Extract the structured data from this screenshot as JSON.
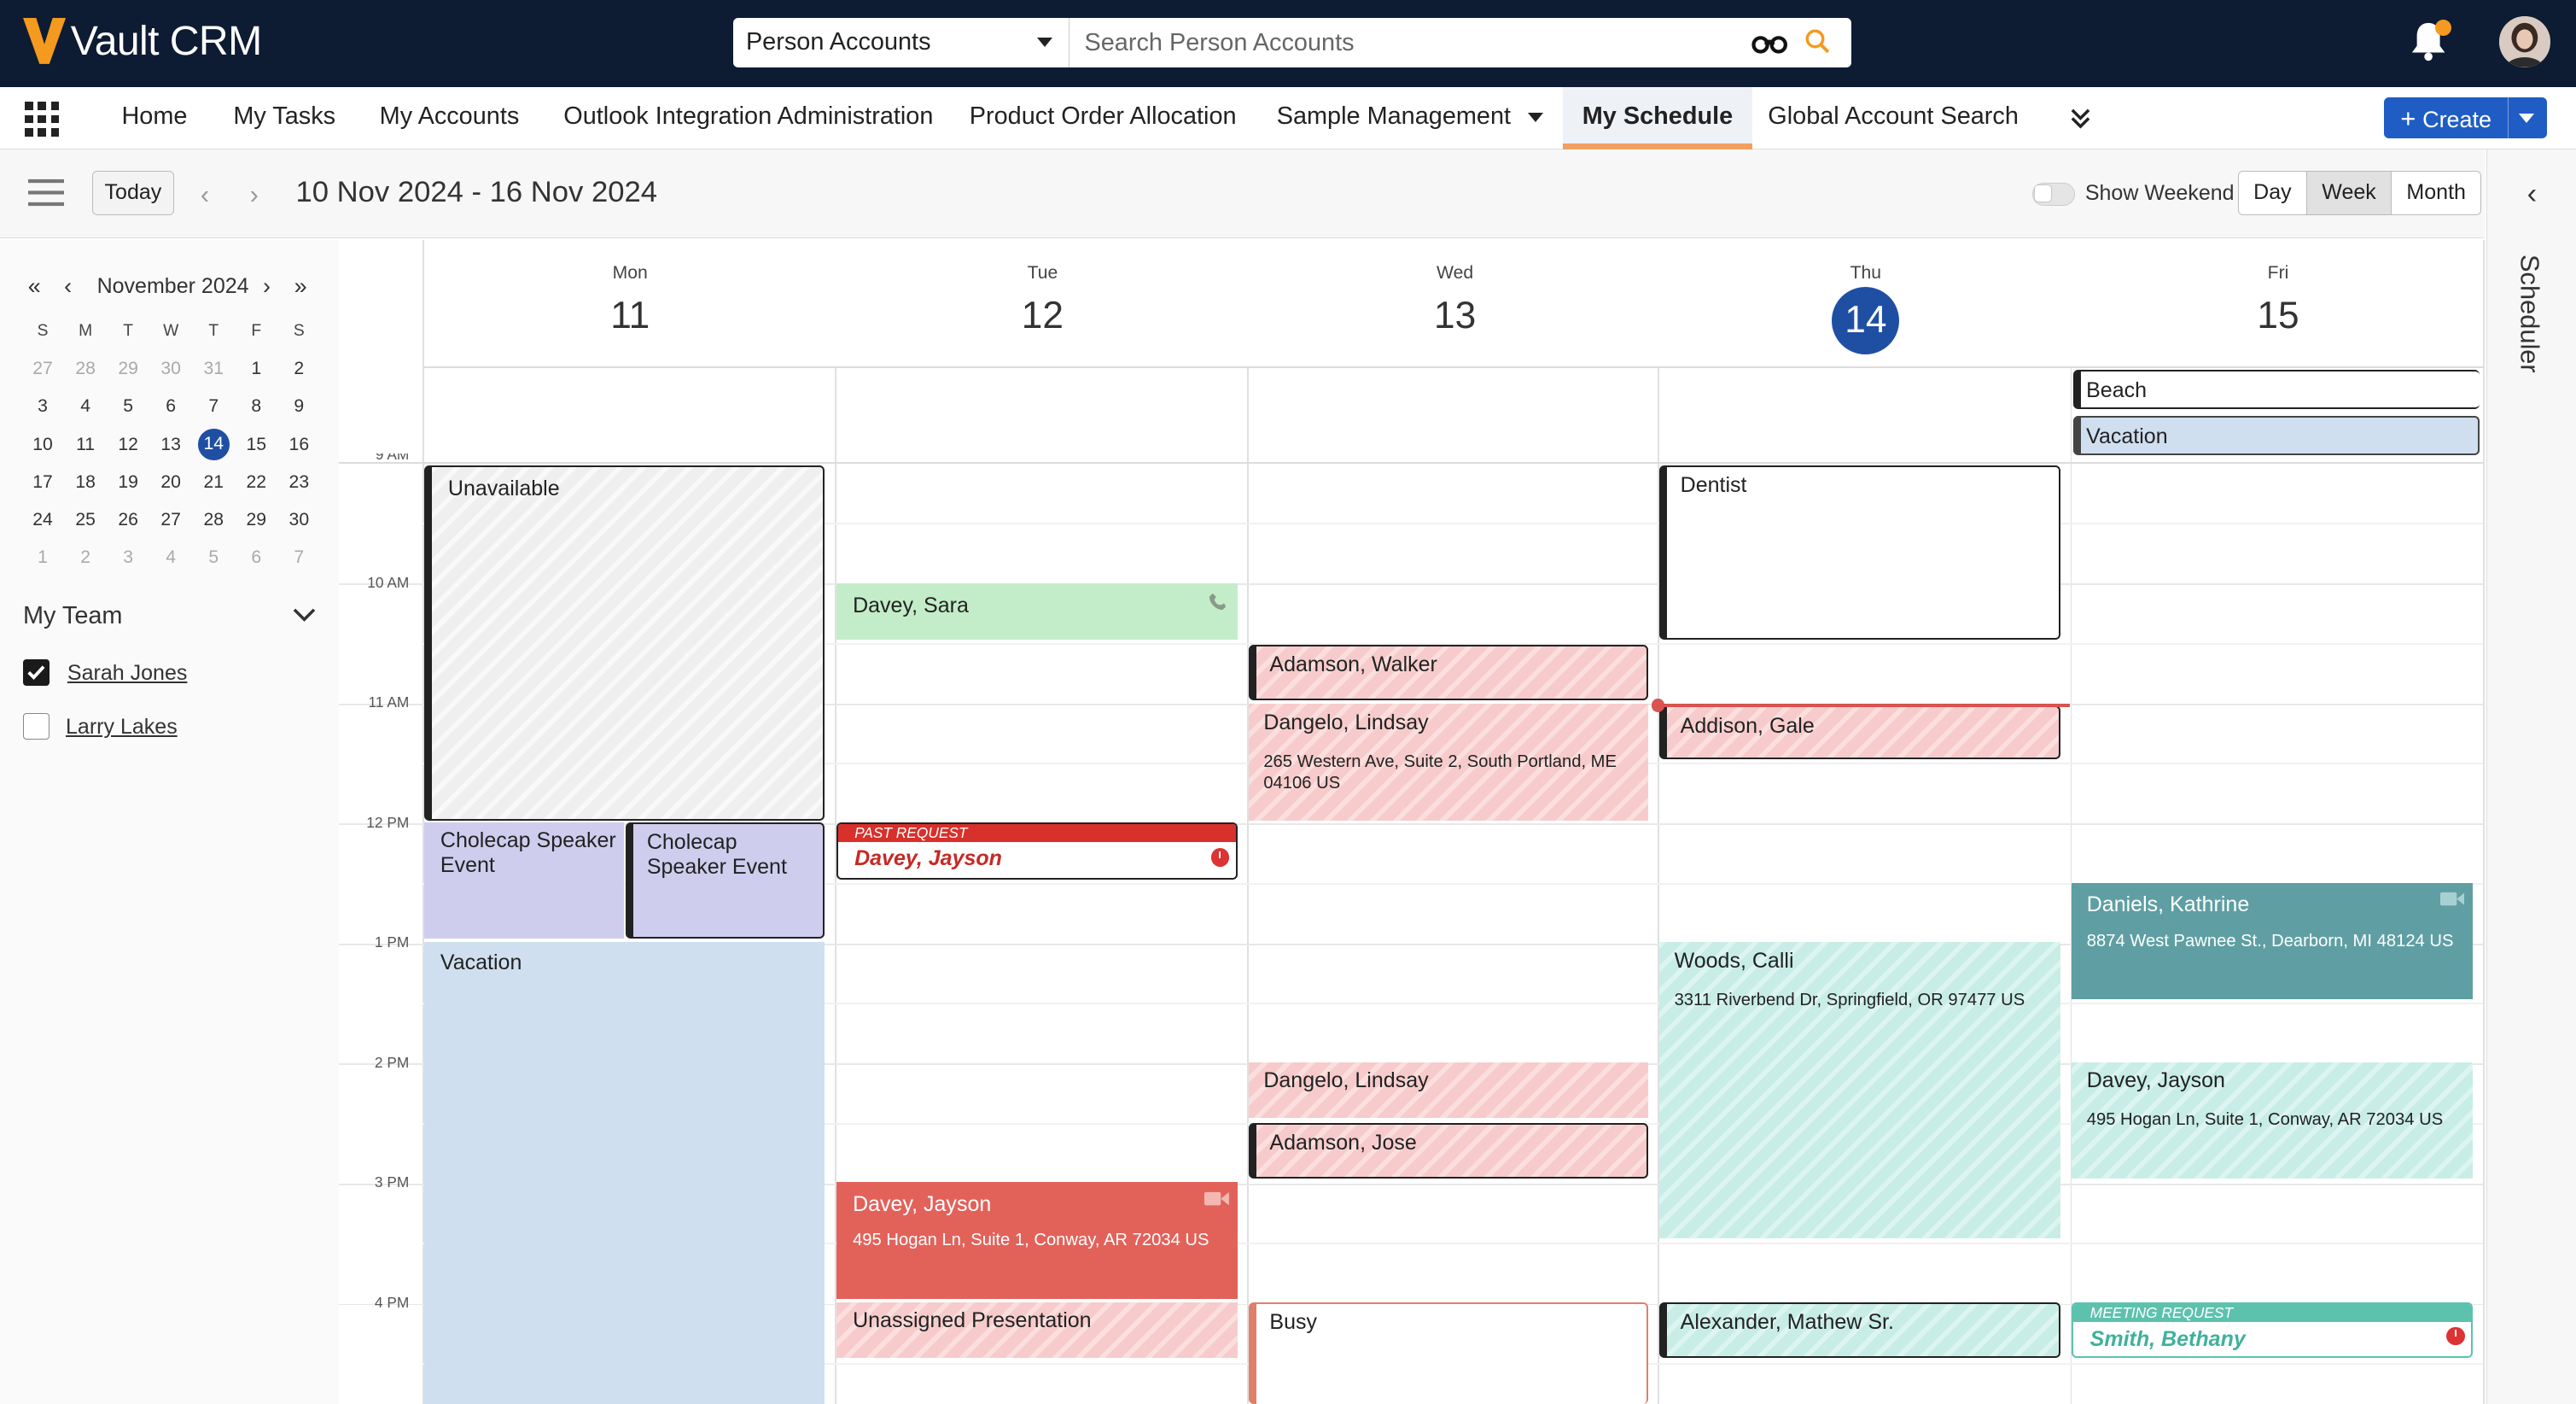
{
  "header": {
    "brand": "Vault CRM",
    "search_object": "Person Accounts",
    "search_placeholder": "Search Person Accounts"
  },
  "nav": {
    "items": [
      "Home",
      "My Tasks",
      "My Accounts",
      "Outlook Integration Administration",
      "Product Order Allocation",
      "Sample Management",
      "My Schedule",
      "Global Account Search"
    ],
    "active": "My Schedule",
    "create_label": "Create"
  },
  "toolbar": {
    "today_label": "Today",
    "date_range": "10 Nov 2024 - 16 Nov 2024",
    "show_weekend_label": "Show Weekend",
    "views": [
      "Day",
      "Week",
      "Month"
    ],
    "active_view": "Week"
  },
  "rail": {
    "label": "Scheduler"
  },
  "mini_calendar": {
    "title": "November 2024",
    "dow": [
      "S",
      "M",
      "T",
      "W",
      "T",
      "F",
      "S"
    ],
    "weeks": [
      [
        "27",
        "28",
        "29",
        "30",
        "31",
        "1",
        "2"
      ],
      [
        "3",
        "4",
        "5",
        "6",
        "7",
        "8",
        "9"
      ],
      [
        "10",
        "11",
        "12",
        "13",
        "14",
        "15",
        "16"
      ],
      [
        "17",
        "18",
        "19",
        "20",
        "21",
        "22",
        "23"
      ],
      [
        "24",
        "25",
        "26",
        "27",
        "28",
        "29",
        "30"
      ],
      [
        "1",
        "2",
        "3",
        "4",
        "5",
        "6",
        "7"
      ]
    ],
    "today": "14"
  },
  "team": {
    "label": "My Team",
    "members": [
      {
        "name": "Sarah Jones",
        "checked": true
      },
      {
        "name": "Larry Lakes",
        "checked": false
      }
    ]
  },
  "days": [
    {
      "dow": "Mon",
      "dom": "11"
    },
    {
      "dow": "Tue",
      "dom": "12"
    },
    {
      "dow": "Wed",
      "dom": "13"
    },
    {
      "dow": "Thu",
      "dom": "14",
      "today": true
    },
    {
      "dow": "Fri",
      "dom": "15"
    }
  ],
  "time_labels": [
    "9 AM",
    "10 AM",
    "11 AM",
    "12 PM",
    "1 PM",
    "2 PM",
    "3 PM",
    "4 PM"
  ],
  "all_day": {
    "beach": "Beach",
    "vacation": "Vacation"
  },
  "events": {
    "unavailable": "Unavailable",
    "cholecap1": "Cholecap Speaker Event",
    "cholecap2": "Cholecap Speaker Event",
    "vacation_mon": "Vacation",
    "davey_sara": "Davey, Sara",
    "past_request_label": "PAST REQUEST",
    "past_request_name": "Davey, Jayson",
    "davey_jayson_tue": "Davey, Jayson",
    "davey_jayson_tue_addr": "495 Hogan Ln, Suite 1, Conway, AR 72034 US",
    "unassigned": "Unassigned Presentation",
    "adamson_walker": "Adamson, Walker",
    "dangelo_lindsay": "Dangelo, Lindsay",
    "dangelo_lindsay_addr": "265 Western Ave, Suite 2, South Portland, ME 04106 US",
    "dangelo_lindsay2": "Dangelo, Lindsay",
    "adamson_jose": "Adamson, Jose",
    "busy": "Busy",
    "dentist": "Dentist",
    "addison_gale": "Addison, Gale",
    "woods_calli": "Woods, Calli",
    "woods_calli_addr": "3311 Riverbend Dr, Springfield, OR 97477 US",
    "alexander": "Alexander, Mathew Sr.",
    "daniels": "Daniels, Kathrine",
    "daniels_addr": "8874 West Pawnee St., Dearborn, MI 48124 US",
    "davey_jayson_fri": "Davey, Jayson",
    "davey_jayson_fri_addr": "495 Hogan Ln, Suite 1, Conway, AR 72034 US",
    "meeting_request_label": "MEETING REQUEST",
    "meeting_request_name": "Smith, Bethany"
  },
  "colors": {
    "topbar": "#0d1b33",
    "accent_blue": "#1f4fa3",
    "nav_active_underline": "#f0a060",
    "past_request": "#d8302b",
    "meeting_request": "#5cc2ae"
  }
}
